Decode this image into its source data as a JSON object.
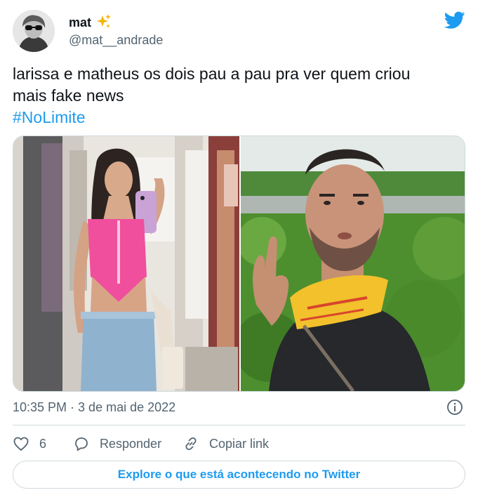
{
  "author": {
    "display_name": "mat",
    "handle": "@mat__andrade",
    "avatar_icon": "avatar-photo",
    "badge_icon": "sparkles-icon"
  },
  "tweet": {
    "text_lines": [
      "larissa e matheus os dois pau a pau pra ver quem criou",
      "mais fake news"
    ],
    "hashtag": "#NoLimite",
    "timestamp": "10:35 PM · 3 de mai de 2022"
  },
  "media": {
    "images": [
      {
        "icon": "photo-woman-mirror-selfie"
      },
      {
        "icon": "photo-man-outdoors-gesturing"
      }
    ]
  },
  "actions": {
    "like_count": "6",
    "reply_label": "Responder",
    "copy_link_label": "Copiar link"
  },
  "explore_label": "Explore o que está acontecendo no Twitter",
  "colors": {
    "brand_blue": "#1d9bf0",
    "secondary_text": "#536471",
    "border": "#cfd9de",
    "primary_text": "#0f1419"
  }
}
